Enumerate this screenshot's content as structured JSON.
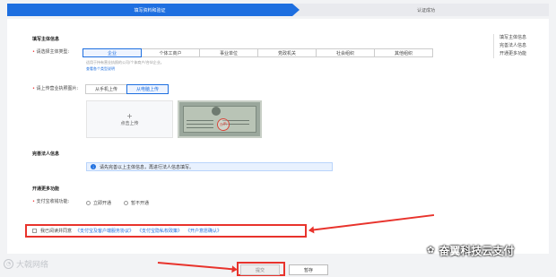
{
  "steps": [
    "填写资料和验证",
    "认证成功"
  ],
  "side_nav": [
    "填写主体信息",
    "完善法人信息",
    "开通更多功能"
  ],
  "section_entity": {
    "title": "填写主体信息",
    "type_label": "请选择主体类型:",
    "types": [
      "企业",
      "个体工商户",
      "事业单位",
      "党政机关",
      "社会组织",
      "其他组织"
    ],
    "hint": "适用于持有营业执照的公司/个体商户/合伙企业。",
    "example_link": "查看各个类型说明"
  },
  "license": {
    "label": "请上传营业执照图片:",
    "tabs": [
      "从手机上传",
      "从电脑上传"
    ],
    "upload_text": "点击上传",
    "sample_stamp": "示例"
  },
  "section_legal": {
    "title": "完善法人信息",
    "info": "请先完善以上主体信息，再进行法人信息填写。"
  },
  "section_more": {
    "title": "开通更多功能",
    "pay_label": "支付宝收钱功能:",
    "options": [
      "立即开通",
      "暂不开通"
    ]
  },
  "agreement": {
    "prefix": "我已阅读并同意",
    "links": [
      "《支付宝及客户端服务协议》",
      "《支付宝隐私权政策》",
      "《开户意愿确认》"
    ]
  },
  "buttons": {
    "submit": "提交",
    "save": "暂存"
  },
  "watermarks": {
    "left": "大戟网络",
    "right": "奋翼科技云支付"
  },
  "colors": {
    "primary": "#1e6fe0",
    "highlight": "#e8332c"
  }
}
